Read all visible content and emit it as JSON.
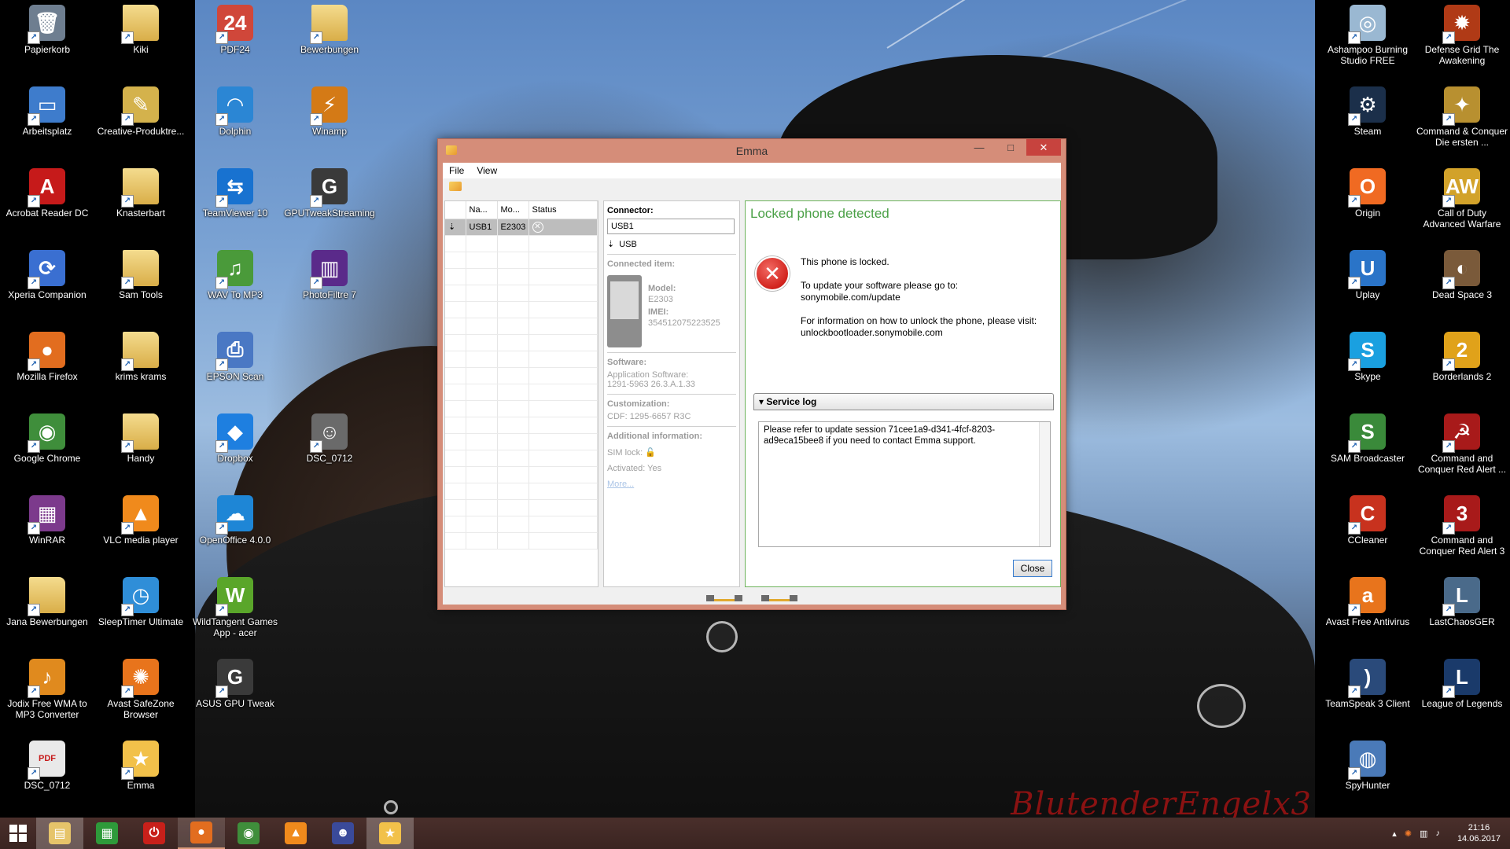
{
  "desktop": {
    "left_col1": [
      {
        "label": "Papierkorb",
        "icon": "recycle-bin-icon",
        "color": "#6e7e90",
        "glyph": "🗑"
      },
      {
        "label": "Arbeitsplatz",
        "icon": "computer-icon",
        "color": "#3e7ccc",
        "glyph": "▭"
      },
      {
        "label": "Acrobat Reader DC",
        "icon": "acrobat-icon",
        "color": "#c61a1a",
        "glyph": "A"
      },
      {
        "label": "Xperia Companion",
        "icon": "xperia-icon",
        "color": "#3a6fd1",
        "glyph": "⟳"
      },
      {
        "label": "Mozilla Firefox",
        "icon": "firefox-icon",
        "color": "#e26d1f",
        "glyph": "●"
      },
      {
        "label": "Google Chrome",
        "icon": "chrome-icon",
        "color": "#3f8e3b",
        "glyph": "◉"
      },
      {
        "label": "WinRAR",
        "icon": "winrar-icon",
        "color": "#7c3a8c",
        "glyph": "▦"
      },
      {
        "label": "Jana Bewerbungen",
        "icon": "folder-icon",
        "color": "#e6c46a",
        "glyph": ""
      },
      {
        "label": "Jodix Free WMA to MP3 Converter",
        "icon": "jodix-icon",
        "color": "#e08a1e",
        "glyph": "♪"
      },
      {
        "label": "DSC_0712",
        "icon": "pdf-icon",
        "color": "#e9e9e9",
        "glyph": "PDF"
      }
    ],
    "left_col2": [
      {
        "label": "Kiki",
        "icon": "folder-icon",
        "color": "#e6c46a",
        "glyph": ""
      },
      {
        "label": "Creative-Produktre...",
        "icon": "creative-icon",
        "color": "#d4b24c",
        "glyph": "✎"
      },
      {
        "label": "Knasterbart",
        "icon": "folder-icon",
        "color": "#e6c46a",
        "glyph": ""
      },
      {
        "label": "Sam Tools",
        "icon": "folder-icon",
        "color": "#e6c46a",
        "glyph": ""
      },
      {
        "label": "krims krams",
        "icon": "folder-icon",
        "color": "#e6c46a",
        "glyph": ""
      },
      {
        "label": "Handy",
        "icon": "folder-icon",
        "color": "#e6c46a",
        "glyph": ""
      },
      {
        "label": "VLC media player",
        "icon": "vlc-icon",
        "color": "#f08a1c",
        "glyph": "▲"
      },
      {
        "label": "SleepTimer Ultimate",
        "icon": "sleeptimer-icon",
        "color": "#2f8ed8",
        "glyph": "◷"
      },
      {
        "label": "Avast SafeZone Browser",
        "icon": "avast-safezone-icon",
        "color": "#e8741c",
        "glyph": "✺"
      },
      {
        "label": "Emma",
        "icon": "emma-icon",
        "color": "#f2c14a",
        "glyph": "★"
      }
    ],
    "left_col3": [
      {
        "label": "PDF24",
        "icon": "pdf24-icon",
        "color": "#d0473a",
        "glyph": "24"
      },
      {
        "label": "Dolphin",
        "icon": "dolphin-icon",
        "color": "#2b86d4",
        "glyph": "◠"
      },
      {
        "label": "TeamViewer 10",
        "icon": "teamviewer-icon",
        "color": "#1872d0",
        "glyph": "⇆"
      },
      {
        "label": "WAV To MP3",
        "icon": "wav-mp3-icon",
        "color": "#4a9a3a",
        "glyph": "♫"
      },
      {
        "label": "EPSON Scan",
        "icon": "epson-scan-icon",
        "color": "#4a78c4",
        "glyph": "⎙"
      },
      {
        "label": "Dropbox",
        "icon": "dropbox-icon",
        "color": "#1e7fe0",
        "glyph": "◆"
      },
      {
        "label": "OpenOffice 4.0.0",
        "icon": "openoffice-icon",
        "color": "#1e86d6",
        "glyph": "☁"
      },
      {
        "label": "WildTangent Games App - acer",
        "icon": "wildtangent-icon",
        "color": "#5aa62a",
        "glyph": "W"
      },
      {
        "label": "ASUS GPU Tweak",
        "icon": "asus-gpu-tweak-icon",
        "color": "#3a3a3a",
        "glyph": "G"
      }
    ],
    "left_col4": [
      {
        "label": "Bewerbungen",
        "icon": "folder-icon",
        "color": "#e6c46a",
        "glyph": ""
      },
      {
        "label": "Winamp",
        "icon": "winamp-icon",
        "color": "#d47a16",
        "glyph": "⚡"
      },
      {
        "label": "GPUTweakStreaming",
        "icon": "gpu-tweak-streaming-icon",
        "color": "#3a3a3a",
        "glyph": "G"
      },
      {
        "label": "PhotoFiltre 7",
        "icon": "photofiltre-icon",
        "color": "#5a2a8a",
        "glyph": "▥"
      },
      {
        "label": "",
        "icon": "blank-icon",
        "color": "rgba(0,0,0,0)",
        "glyph": ""
      },
      {
        "label": "DSC_0712",
        "icon": "photo-thumbnail-icon",
        "color": "#6a6a6a",
        "glyph": "☺"
      }
    ],
    "right_col1": [
      {
        "label": "Ashampoo Burning Studio FREE",
        "icon": "ashampoo-icon",
        "color": "#9ab8d2",
        "glyph": "◎"
      },
      {
        "label": "Steam",
        "icon": "steam-icon",
        "color": "#1b2f4a",
        "glyph": "⚙"
      },
      {
        "label": "Origin",
        "icon": "origin-icon",
        "color": "#f06a22",
        "glyph": "O"
      },
      {
        "label": "Uplay",
        "icon": "uplay-icon",
        "color": "#2a74c8",
        "glyph": "U"
      },
      {
        "label": "Skype",
        "icon": "skype-icon",
        "color": "#1aa0e0",
        "glyph": "S"
      },
      {
        "label": "SAM Broadcaster",
        "icon": "sam-broadcaster-icon",
        "color": "#3a8a3a",
        "glyph": "S"
      },
      {
        "label": "CCleaner",
        "icon": "ccleaner-icon",
        "color": "#c8321e",
        "glyph": "C"
      },
      {
        "label": "Avast Free Antivirus",
        "icon": "avast-icon",
        "color": "#e8741c",
        "glyph": "a"
      },
      {
        "label": "TeamSpeak 3 Client",
        "icon": "teamspeak-icon",
        "color": "#2a4a7a",
        "glyph": ")"
      },
      {
        "label": "SpyHunter",
        "icon": "spyhunter-icon",
        "color": "#4a7ab8",
        "glyph": "◍"
      }
    ],
    "right_col2": [
      {
        "label": "Defense Grid The Awakening",
        "icon": "defense-grid-icon",
        "color": "#b03a16",
        "glyph": "✹"
      },
      {
        "label": "Command & Conquer Die ersten ...",
        "icon": "cnc-first-icon",
        "color": "#b89030",
        "glyph": "✦"
      },
      {
        "label": "Call of Duty Advanced Warfare",
        "icon": "cod-aw-icon",
        "color": "#d2a22a",
        "glyph": "AW"
      },
      {
        "label": "Dead Space 3",
        "icon": "dead-space-icon",
        "color": "#7a5a3a",
        "glyph": "◐"
      },
      {
        "label": "Borderlands 2",
        "icon": "borderlands-icon",
        "color": "#e0a21a",
        "glyph": "2"
      },
      {
        "label": "Command and Conquer Red Alert ...",
        "icon": "red-alert-icon",
        "color": "#a81a1a",
        "glyph": "☭"
      },
      {
        "label": "Command and Conquer Red Alert 3",
        "icon": "red-alert-3-icon",
        "color": "#a81a1a",
        "glyph": "3"
      },
      {
        "label": "LastChaosGER",
        "icon": "lastchaos-icon",
        "color": "#4a6a8a",
        "glyph": "L"
      },
      {
        "label": "League of Legends",
        "icon": "league-icon",
        "color": "#1a3a6a",
        "glyph": "L"
      }
    ]
  },
  "wallpaper": {
    "signature": "BlutenderEngelx3"
  },
  "window": {
    "title": "Emma",
    "minimize": "—",
    "maximize": "□",
    "close": "✕",
    "menu": {
      "file": "File",
      "view": "View"
    },
    "device_table": {
      "headers": [
        "Na...",
        "Mo...",
        "Status"
      ],
      "rows": [
        {
          "name": "USB1",
          "model": "E2303",
          "status": "✕"
        }
      ]
    },
    "info": {
      "connector_heading": "Connector:",
      "connector_value": "USB1",
      "connector_type": "USB",
      "connected_item_heading": "Connected item:",
      "model_label": "Model:",
      "model_value": "E2303",
      "imei_label": "IMEI:",
      "imei_value": "354512075223525",
      "software_heading": "Software:",
      "software_label": "Application Software:",
      "software_value": "1291-5963 26.3.A.1.33",
      "customization_heading": "Customization:",
      "customization_value": "CDF: 1295-6657 R3C",
      "additional_heading": "Additional information:",
      "sim_lock": "SIM lock:",
      "activated": "Activated: Yes",
      "more": "More..."
    },
    "message": {
      "title": "Locked phone detected",
      "line1": "This phone is locked.",
      "line2": "To update your software please go to:",
      "line3": "sonymobile.com/update",
      "line4": "For information on how to unlock the phone, please visit:",
      "line5": "unlockbootloader.sonymobile.com",
      "service_log_label": "Service log",
      "service_log_text": "Please refer to update session 71cee1a9-d341-4fcf-8203-ad9eca15bee8 if you need to contact Emma support.",
      "close_button": "Close"
    }
  },
  "taskbar": {
    "apps": [
      {
        "name": "taskbar-file-explorer",
        "icon": "folder-icon",
        "color": "#e6c46a",
        "glyph": "▤",
        "state": "running"
      },
      {
        "name": "taskbar-store",
        "icon": "store-icon",
        "color": "#2e9a3a",
        "glyph": "▦",
        "state": "normal"
      },
      {
        "name": "taskbar-sleeptimer",
        "icon": "power-icon",
        "color": "#c8201a",
        "glyph": "⏻",
        "state": "normal"
      },
      {
        "name": "taskbar-firefox",
        "icon": "firefox-icon",
        "color": "#e26d1f",
        "glyph": "●",
        "state": "active"
      },
      {
        "name": "taskbar-chrome",
        "icon": "chrome-icon",
        "color": "#3f8e3b",
        "glyph": "◉",
        "state": "normal"
      },
      {
        "name": "taskbar-vlc",
        "icon": "vlc-icon",
        "color": "#f08a1c",
        "glyph": "▲",
        "state": "normal"
      },
      {
        "name": "taskbar-game",
        "icon": "game-icon",
        "color": "#3a4a9a",
        "glyph": "☻",
        "state": "normal"
      },
      {
        "name": "taskbar-emma",
        "icon": "emma-icon",
        "color": "#f2c14a",
        "glyph": "★",
        "state": "running"
      }
    ],
    "clock_time": "21:16",
    "clock_date": "14.06.2017"
  },
  "colors": {
    "taskbar": "#3f2825",
    "window_frame": "#d58d79",
    "message_title": "#4aa046",
    "error_red": "#d2231d"
  }
}
